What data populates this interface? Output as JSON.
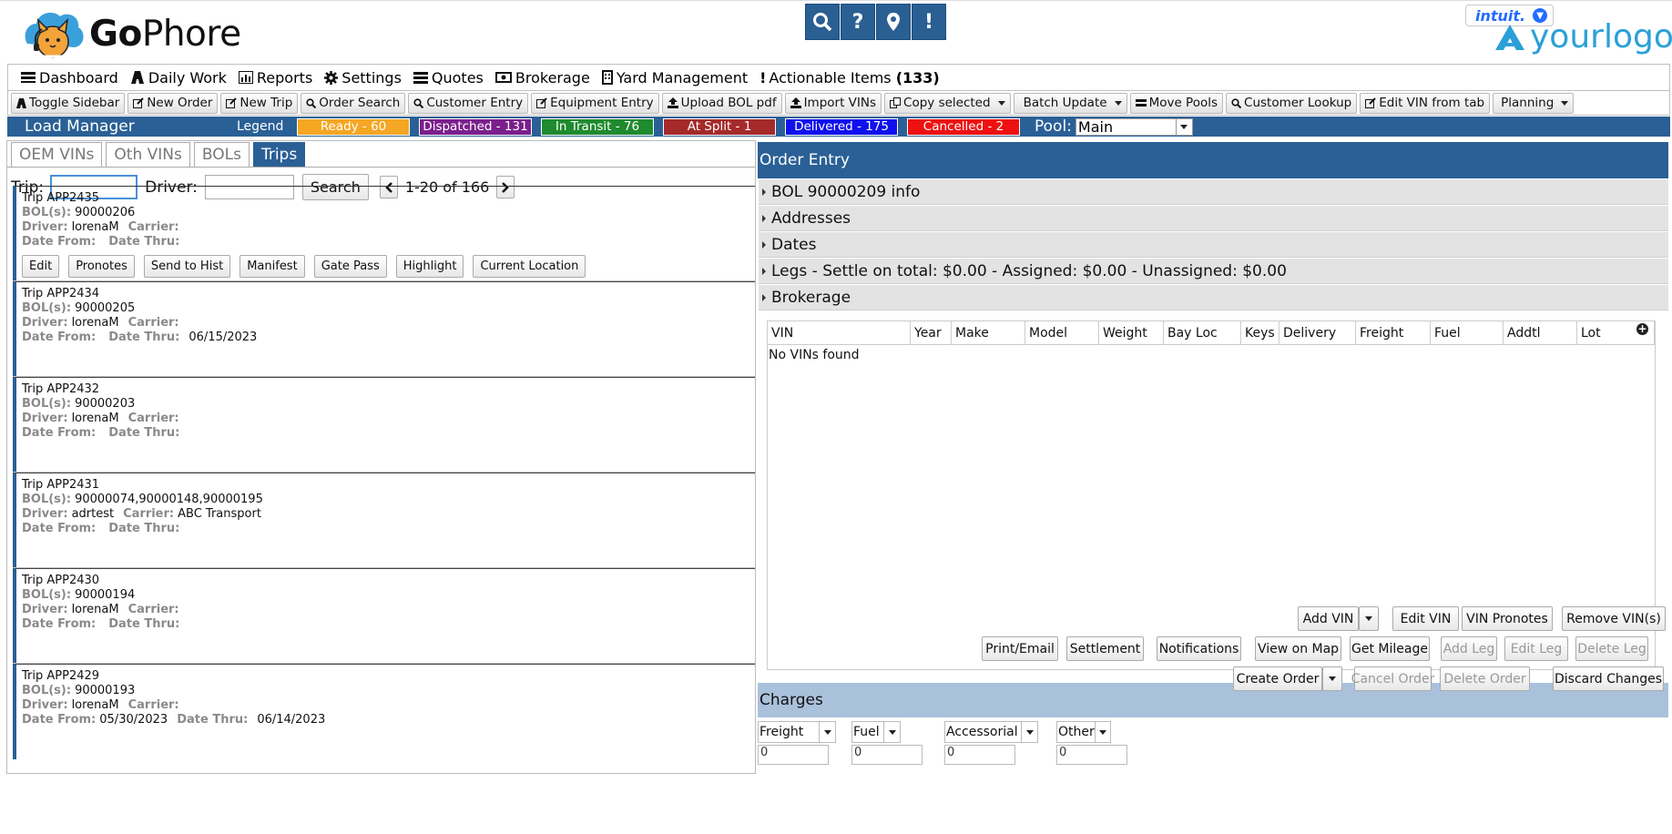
{
  "brand": {
    "logo_bold": "Go",
    "logo_rest": "Phore",
    "intuit": "intuit.",
    "yourlogo": "yourlogo"
  },
  "nav": [
    {
      "label": "Dashboard",
      "icon": "dashboard-icon"
    },
    {
      "label": "Daily Work",
      "icon": "road-icon"
    },
    {
      "label": "Reports",
      "icon": "chart-icon"
    },
    {
      "label": "Settings",
      "icon": "gear-icon"
    },
    {
      "label": "Quotes",
      "icon": "stack-icon"
    },
    {
      "label": "Brokerage",
      "icon": "money-icon"
    },
    {
      "label": "Yard Management",
      "icon": "building-icon"
    },
    {
      "label": "Actionable Items",
      "icon": "exclamation-icon",
      "count": "(133)"
    }
  ],
  "toolbar": [
    "Toggle Sidebar",
    "New Order",
    "New Trip",
    "Order Search",
    "Customer Entry",
    "Equipment Entry",
    "Upload BOL pdf",
    "Import VINs",
    "Copy selected",
    "Batch Update",
    "Move Pools",
    "Customer Lookup",
    "Edit VIN from tab",
    "Planning"
  ],
  "legend": {
    "title": "Load Manager",
    "label": "Legend",
    "chips": [
      {
        "label": "Ready - 60",
        "color": "#f5a623"
      },
      {
        "label": "Dispatched - 131",
        "color": "#7b1f8c"
      },
      {
        "label": "In Transit - 76",
        "color": "#1f8a2e"
      },
      {
        "label": "At Split - 1",
        "color": "#a52a2a"
      },
      {
        "label": "Delivered - 175",
        "color": "#1010ee"
      },
      {
        "label": "Cancelled - 2",
        "color": "#ee1111"
      }
    ],
    "pool_label": "Pool:",
    "pool_value": "Main"
  },
  "left": {
    "tabs": [
      "OEM VINs",
      "Oth VINs",
      "BOLs",
      "Trips"
    ],
    "trip_label": "Trip:",
    "driver_label": "Driver:",
    "search_button": "Search",
    "pager": "1-20 of 166",
    "field_labels": {
      "bols": "BOL(s):",
      "driver": "Driver:",
      "carrier": "Carrier:",
      "date_from": "Date From:",
      "date_thru": "Date Thru:"
    },
    "actions": [
      "Edit",
      "Pronotes",
      "Send to Hist",
      "Manifest",
      "Gate Pass",
      "Highlight",
      "Current Location"
    ],
    "trips": [
      {
        "title": "Trip APP2435",
        "bols": "90000206",
        "driver": "lorenaM",
        "carrier": "",
        "date_from": "",
        "date_thru": ""
      },
      {
        "title": "Trip APP2434",
        "bols": "90000205",
        "driver": "lorenaM",
        "carrier": "",
        "date_from": "",
        "date_thru": "06/15/2023"
      },
      {
        "title": "Trip APP2432",
        "bols": "90000203",
        "driver": "lorenaM",
        "carrier": "",
        "date_from": "",
        "date_thru": ""
      },
      {
        "title": "Trip APP2431",
        "bols": "90000074,90000148,90000195",
        "driver": "adrtest",
        "carrier": "ABC Transport",
        "date_from": "",
        "date_thru": ""
      },
      {
        "title": "Trip APP2430",
        "bols": "90000194",
        "driver": "lorenaM",
        "carrier": "",
        "date_from": "",
        "date_thru": ""
      },
      {
        "title": "Trip APP2429",
        "bols": "90000193",
        "driver": "lorenaM",
        "carrier": "",
        "date_from": "05/30/2023",
        "date_thru": "06/14/2023"
      }
    ]
  },
  "right": {
    "title": "Order Entry",
    "sections": [
      "BOL 90000209 info",
      "Addresses",
      "Dates",
      "Legs - Settle on total: $0.00 - Assigned: $0.00 - Unassigned: $0.00",
      "Brokerage"
    ],
    "vin_columns": [
      "VIN",
      "Year",
      "Make",
      "Model",
      "Weight",
      "Bay Loc",
      "Keys",
      "Delivery",
      "Freight",
      "Fuel",
      "Addtl",
      "Lot"
    ],
    "no_vins": "No VINs found",
    "charges_title": "Charges",
    "charges": [
      {
        "label": "Freight",
        "value": "0"
      },
      {
        "label": "Fuel",
        "value": "0"
      },
      {
        "label": "Accessorial",
        "value": "0"
      },
      {
        "label": "Other",
        "value": "0"
      }
    ],
    "vin_buttons": [
      "Add VIN",
      "Edit VIN",
      "VIN Pronotes",
      "Remove VIN(s)"
    ],
    "row2_buttons": [
      "Print/Email",
      "Settlement",
      "Notifications",
      "View on Map",
      "Get Mileage",
      "Add Leg",
      "Edit Leg",
      "Delete Leg"
    ],
    "row3_buttons": [
      "Create Order",
      "Cancel Order",
      "Delete Order",
      "Discard Changes"
    ]
  }
}
